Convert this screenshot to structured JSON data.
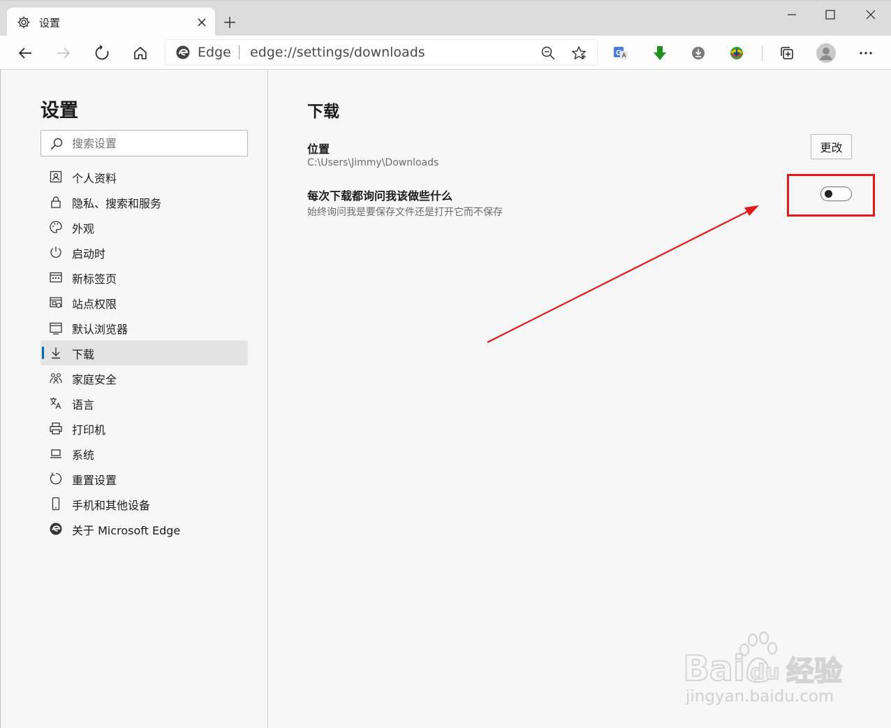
{
  "tab": {
    "title": "设置",
    "icon": "gear-icon",
    "close_icon": "close-icon",
    "new_tab_icon": "plus-icon"
  },
  "window_controls": [
    "minimize-icon",
    "maximize-icon",
    "close-icon"
  ],
  "toolbar": {
    "back_icon": "back-arrow-icon",
    "forward_icon": "forward-arrow-icon",
    "refresh_icon": "refresh-icon",
    "home_icon": "home-icon",
    "site_name": "Edge",
    "url_scheme": "edge://",
    "url_path": "settings/downloads",
    "zoom_icon": "zoom-icon",
    "favorite_icon": "star-icon",
    "extensions": [
      "translate-icon",
      "green-download-arrow-icon",
      "download-circle-icon",
      "idm-extension-icon"
    ],
    "collections_icon": "collections-icon",
    "profile_icon": "profile-avatar-icon",
    "menu_icon": "more-dots-icon"
  },
  "sidebar": {
    "title": "设置",
    "search_placeholder": "搜索设置",
    "items": [
      {
        "label": "个人资料",
        "icon": "profile-icon",
        "active": false
      },
      {
        "label": "隐私、搜索和服务",
        "icon": "lock-icon",
        "active": false
      },
      {
        "label": "外观",
        "icon": "palette-icon",
        "active": false
      },
      {
        "label": "启动时",
        "icon": "power-icon",
        "active": false
      },
      {
        "label": "新标签页",
        "icon": "new-tab-page-icon",
        "active": false
      },
      {
        "label": "站点权限",
        "icon": "site-permissions-icon",
        "active": false
      },
      {
        "label": "默认浏览器",
        "icon": "default-browser-icon",
        "active": false
      },
      {
        "label": "下载",
        "icon": "download-icon",
        "active": true
      },
      {
        "label": "家庭安全",
        "icon": "family-icon",
        "active": false
      },
      {
        "label": "语言",
        "icon": "language-icon",
        "active": false
      },
      {
        "label": "打印机",
        "icon": "printer-icon",
        "active": false
      },
      {
        "label": "系统",
        "icon": "laptop-icon",
        "active": false
      },
      {
        "label": "重置设置",
        "icon": "reset-icon",
        "active": false
      },
      {
        "label": "手机和其他设备",
        "icon": "phone-icon",
        "active": false
      },
      {
        "label": "关于 Microsoft Edge",
        "icon": "edge-logo-icon",
        "active": false
      }
    ]
  },
  "main": {
    "title": "下载",
    "location": {
      "label": "位置",
      "path": "C:\\Users\\Jimmy\\Downloads",
      "button_label": "更改"
    },
    "ask_each_time": {
      "label": "每次下载都询问我该做些什么",
      "description": "始终询问我是要保存文件还是打开它而不保存",
      "enabled": false
    }
  },
  "annotation": {
    "color": "#e31818"
  },
  "watermark": {
    "logo_text": "Bai",
    "logo_text_2": "du",
    "logo_suffix": "经验",
    "url": "jingyan.baidu.com"
  },
  "colors": {
    "accent": "#0067c0",
    "tab_strip": "#dcdcdc",
    "page_bg": "#f7f7f7"
  }
}
